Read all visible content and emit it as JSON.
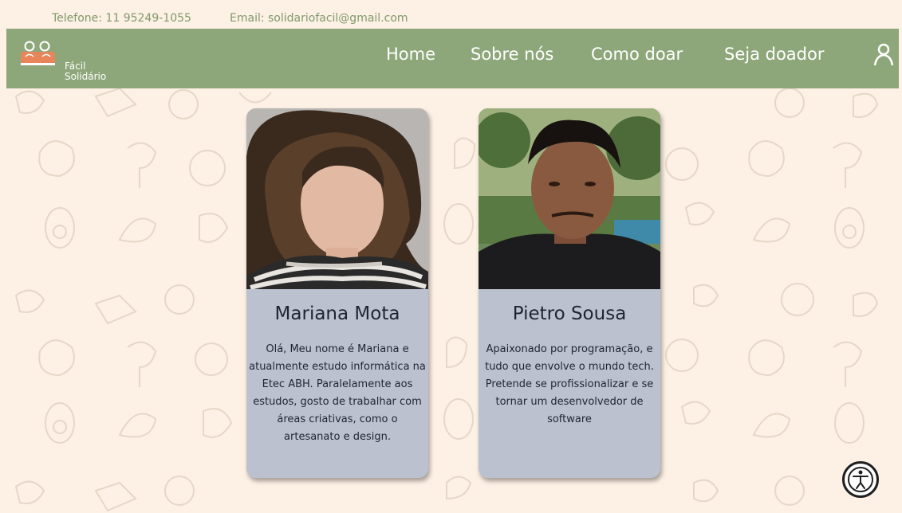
{
  "topbar": {
    "phone": "Telefone: 11 95249-1055",
    "email": "Email: solidariofacil@gmail.com"
  },
  "brand": {
    "line1": "Fácil",
    "line2": "Solidário"
  },
  "nav": {
    "items": [
      {
        "label": "Home"
      },
      {
        "label": "Sobre nós"
      },
      {
        "label": "Como doar"
      },
      {
        "label": "Seja doador"
      }
    ],
    "user_icon": "user-icon"
  },
  "cards": [
    {
      "name": "Mariana Mota",
      "bio": "Olá, Meu nome é Mariana e atualmente estudo informática na Etec ABH. Paralelamente aos estudos, gosto de trabalhar com áreas criativas, como o artesanato e design."
    },
    {
      "name": "Pietro Sousa",
      "bio": "Apaixonado por programação, e tudo que envolve o mundo tech. Pretende se profissionalizar e se tornar um desenvolvedor de software"
    }
  ],
  "colors": {
    "background": "#fdf0e4",
    "navbar": "#8ea77a",
    "card": "#bcc1cf",
    "topbar_text": "#7f9a6c"
  },
  "accessibility_icon": "accessibility-icon"
}
